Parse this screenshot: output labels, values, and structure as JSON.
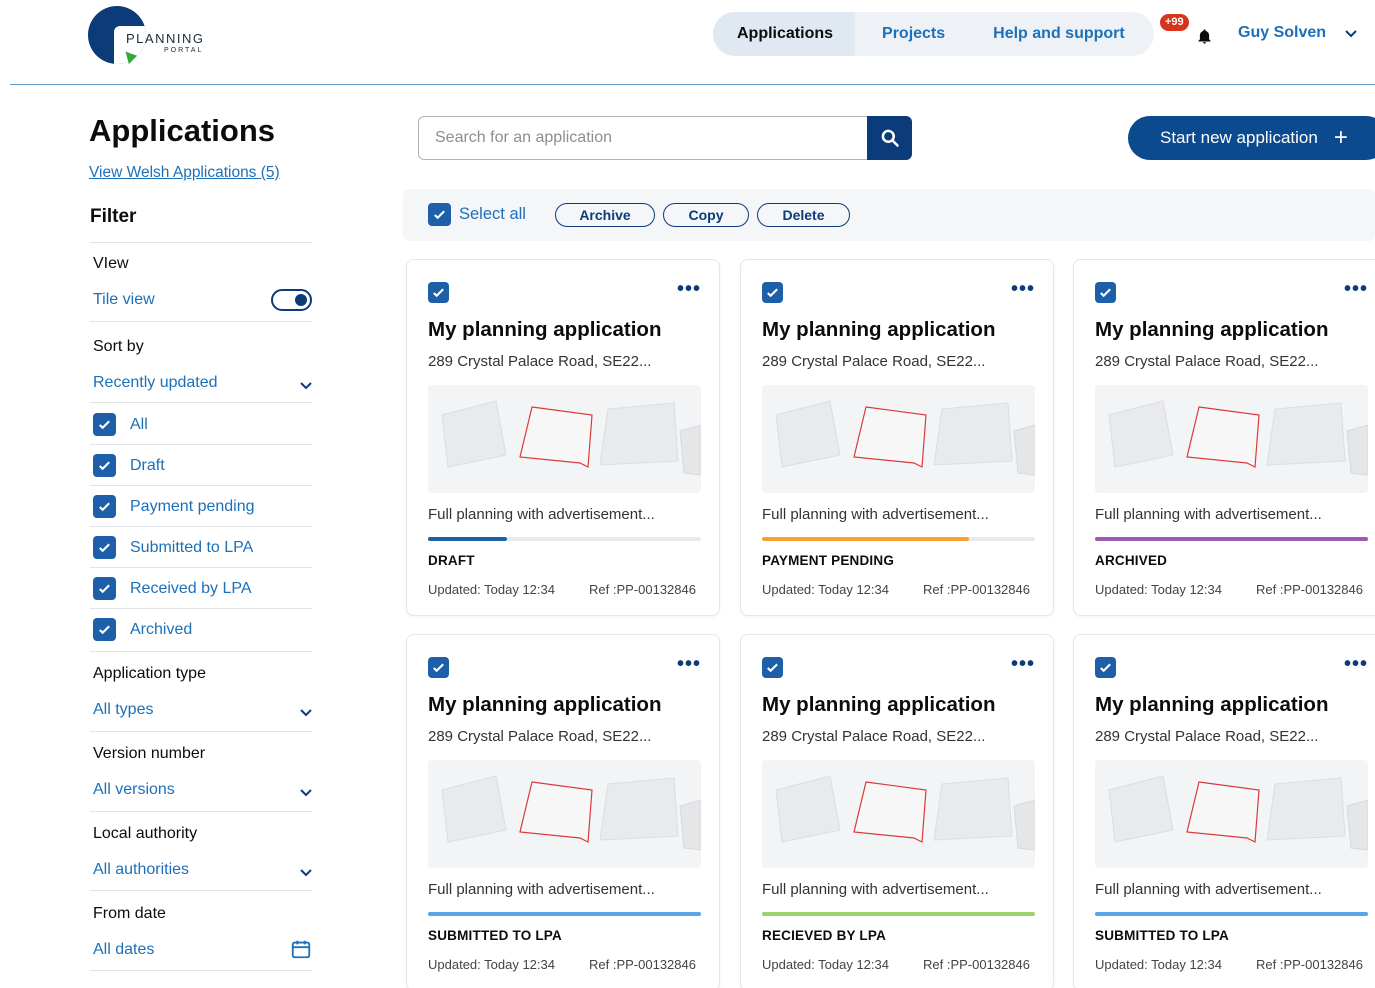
{
  "header": {
    "logo_text": "PLANNING",
    "logo_sub": "PORTAL",
    "nav": [
      "Applications",
      "Projects",
      "Help and support"
    ],
    "notification_badge": "+99",
    "user_name": "Guy Solven"
  },
  "sidebar": {
    "title": "Applications",
    "welsh_link": "View Welsh Applications (5)",
    "filter_heading": "Filter",
    "view_label": "VIew",
    "view_value": "Tile view",
    "sort_label": "Sort by",
    "sort_value": "Recently updated",
    "statuses": [
      "All",
      "Draft",
      "Payment pending",
      "Submitted to LPA",
      "Received by LPA",
      "Archived"
    ],
    "type_label": "Application type",
    "type_value": "All types",
    "version_label": "Version number",
    "version_value": "All versions",
    "authority_label": "Local authority",
    "authority_value": "All authorities",
    "date_label": "From date",
    "date_value": "All dates"
  },
  "search": {
    "placeholder": "Search for an application"
  },
  "start_button": "Start new application",
  "actions": {
    "select_all": "Select all",
    "archive": "Archive",
    "copy": "Copy",
    "delete": "Delete"
  },
  "cards": [
    {
      "title": "My planning application",
      "address": "289 Crystal Palace Road, SE22...",
      "type": "Full planning with advertisement...",
      "status": "DRAFT",
      "progress": 0.29,
      "color": "#1d5fa8",
      "updated": "Updated: Today 12:34",
      "ref": "Ref :PP-00132846"
    },
    {
      "title": "My planning application",
      "address": "289 Crystal Palace Road, SE22...",
      "type": "Full planning with advertisement...",
      "status": "PAYMENT PENDING",
      "progress": 0.76,
      "color": "#f4a236",
      "updated": "Updated: Today 12:34",
      "ref": "Ref :PP-00132846"
    },
    {
      "title": "My planning application",
      "address": "289 Crystal Palace Road, SE22...",
      "type": "Full planning with advertisement...",
      "status": "ARCHIVED",
      "progress": 1.0,
      "color": "#9b5ab8",
      "updated": "Updated: Today 12:34",
      "ref": "Ref :PP-00132846"
    },
    {
      "title": "My planning application",
      "address": "289 Crystal Palace Road, SE22...",
      "type": "Full planning with advertisement...",
      "status": "SUBMITTED TO LPA",
      "progress": 1.0,
      "color": "#5aa4e8",
      "updated": "Updated: Today 12:34",
      "ref": "Ref :PP-00132846"
    },
    {
      "title": "My planning application",
      "address": "289 Crystal Palace Road, SE22...",
      "type": "Full planning with advertisement...",
      "status": "RECIEVED BY LPA",
      "progress": 1.0,
      "color": "#9bd26a",
      "updated": "Updated: Today 12:34",
      "ref": "Ref :PP-00132846"
    },
    {
      "title": "My planning application",
      "address": "289 Crystal Palace Road, SE22...",
      "type": "Full planning with advertisement...",
      "status": "SUBMITTED TO LPA",
      "progress": 1.0,
      "color": "#5aa4e8",
      "updated": "Updated: Today 12:34",
      "ref": "Ref :PP-00132846"
    }
  ]
}
